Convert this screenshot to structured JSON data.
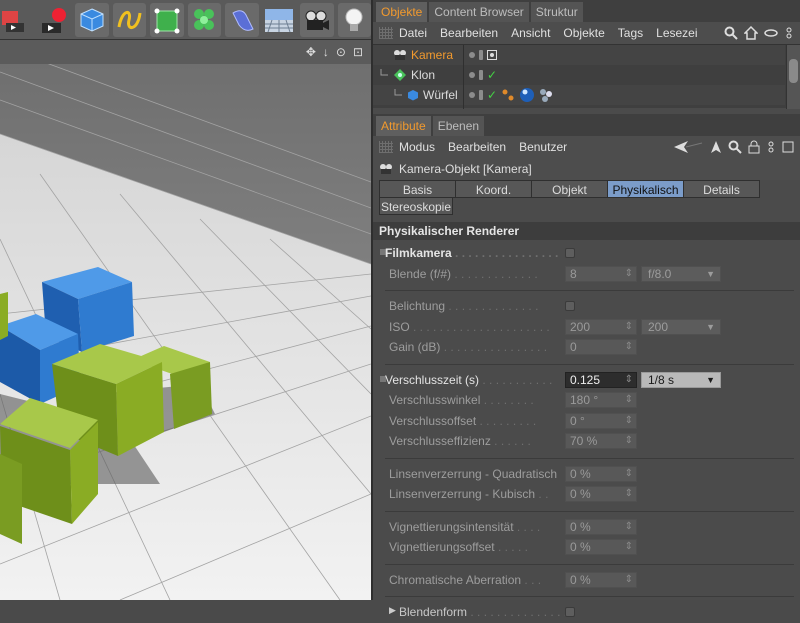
{
  "toolbar": {
    "buttons": [
      "render-settings-icon",
      "render-icon",
      "cube-icon",
      "spline-icon",
      "subdivision-icon",
      "cloner-icon",
      "deformer-icon",
      "floor-icon",
      "camera-icon",
      "light-icon"
    ]
  },
  "viewport": {
    "header_icons": [
      "✥",
      "↓",
      "⊙",
      "⊡"
    ]
  },
  "object_manager": {
    "tabs": [
      "Objekte",
      "Content Browser",
      "Struktur"
    ],
    "menu": [
      "Datei",
      "Bearbeiten",
      "Ansicht",
      "Objekte",
      "Tags",
      "Lesezei"
    ],
    "objects": [
      {
        "name": "Kamera",
        "selected": true
      },
      {
        "name": "Klon",
        "selected": false
      },
      {
        "name": "Würfel",
        "selected": false
      }
    ]
  },
  "attribute_manager": {
    "tabs": [
      "Attribute",
      "Ebenen"
    ],
    "menu": [
      "Modus",
      "Bearbeiten",
      "Benutzer"
    ],
    "object_title": "Kamera-Objekt [Kamera]",
    "subtabs": [
      "Basis",
      "Koord.",
      "Objekt",
      "Physikalisch",
      "Details",
      "Stereoskopie"
    ],
    "active_subtab": "Physikalisch",
    "section_title": "Physikalischer Renderer",
    "params": {
      "filmkamera": {
        "label": "Filmkamera"
      },
      "blende": {
        "label": "Blende (f/#)",
        "value": "8",
        "dropdown": "f/8.0"
      },
      "belichtung": {
        "label": "Belichtung"
      },
      "iso": {
        "label": "ISO",
        "value": "200",
        "dropdown": "200"
      },
      "gain": {
        "label": "Gain (dB)",
        "value": "0"
      },
      "verschlusszeit": {
        "label": "Verschlusszeit (s)",
        "value": "0.125",
        "dropdown": "1/8 s"
      },
      "verschlusswinkel": {
        "label": "Verschlusswinkel",
        "value": "180 °"
      },
      "verschlussoffset": {
        "label": "Verschlussoffset",
        "value": "0 °"
      },
      "verschlusseffizienz": {
        "label": "Verschlusseffizienz",
        "value": "70 %"
      },
      "linsen_quad": {
        "label": "Linsenverzerrung - Quadratisch",
        "value": "0 %"
      },
      "linsen_kub": {
        "label": "Linsenverzerrung - Kubisch",
        "value": "0 %"
      },
      "vig_int": {
        "label": "Vignettierungsintensität",
        "value": "0 %"
      },
      "vig_off": {
        "label": "Vignettierungsoffset",
        "value": "0 %"
      },
      "chrom": {
        "label": "Chromatische Aberration",
        "value": "0 %"
      },
      "blendenform": {
        "label": "Blendenform"
      }
    }
  },
  "colors": {
    "accent": "#f29a2e",
    "active_tab": "#7b9cc9",
    "check_green": "#44d244",
    "cube_blue": "#2f7bd0",
    "cube_green": "#8aac24"
  }
}
